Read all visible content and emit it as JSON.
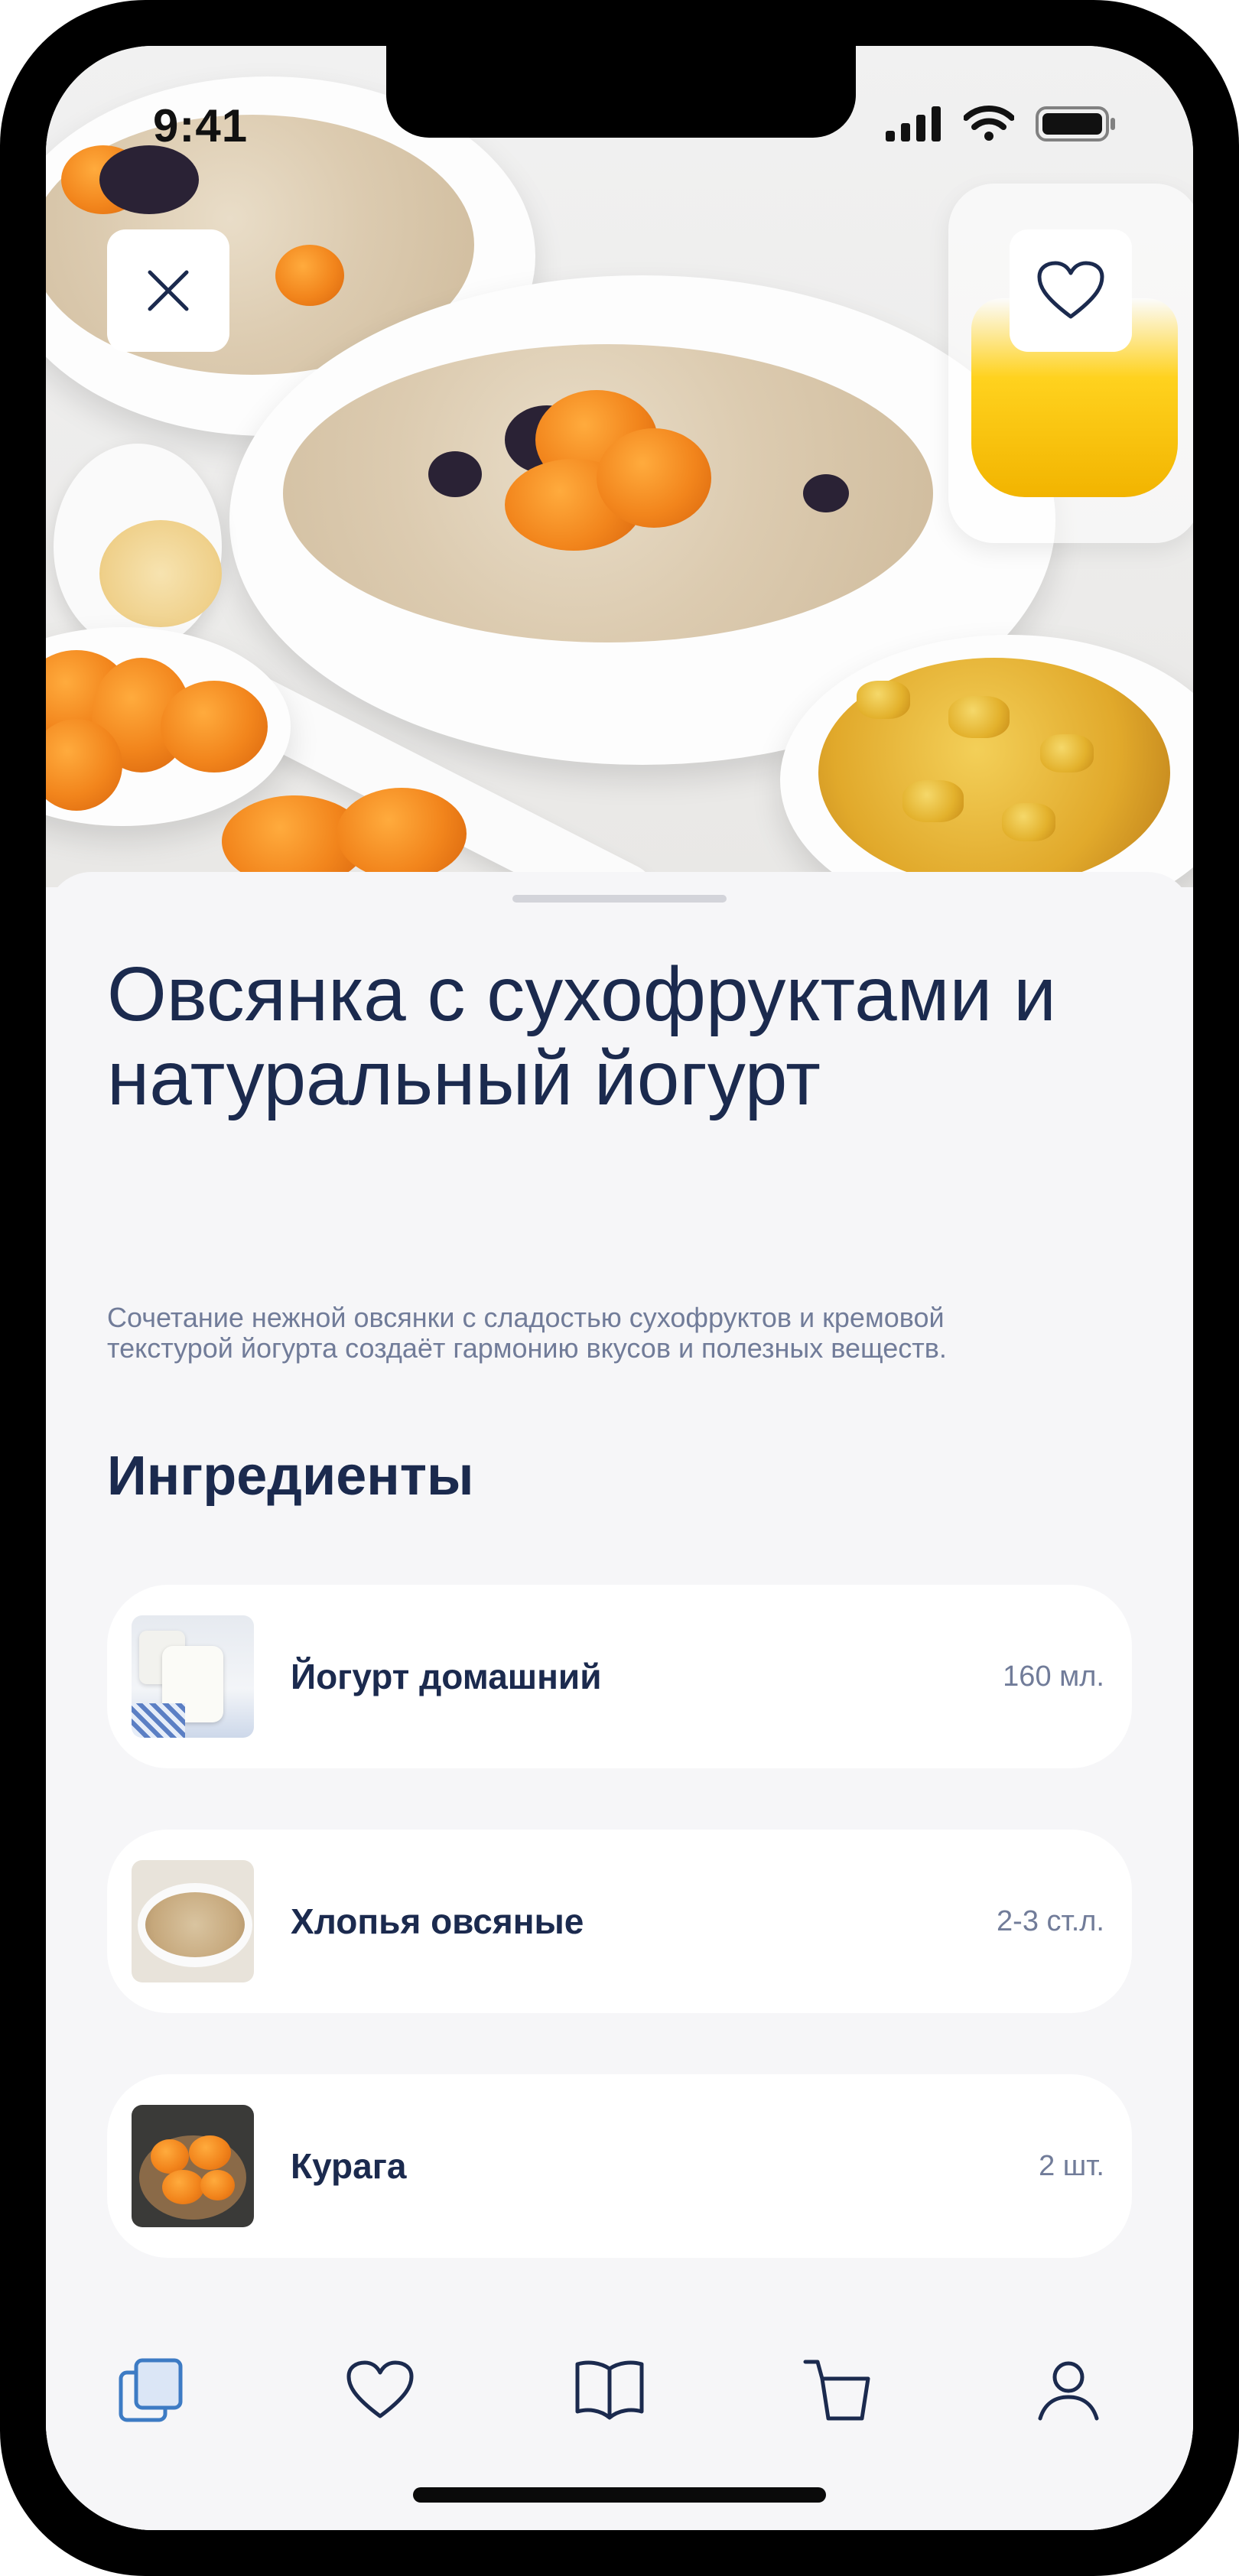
{
  "status_bar": {
    "time": "9:41"
  },
  "hero": {
    "image": "oatmeal-with-dried-fruits-photo",
    "close_icon": "close-icon",
    "favorite_icon": "heart-icon"
  },
  "recipe": {
    "title": "Овсянка с сухофруктами и натуральный йогурт",
    "description": "Сочетание нежной овсянки с сладостью сухофруктов и кремовой текстурой йогурта создаёт гармонию вкусов и полезных веществ."
  },
  "ingredients": {
    "heading": "Ингредиенты",
    "items": [
      {
        "name": "Йогурт домашний",
        "qty": "160 мл.",
        "image": "yogurt-jars"
      },
      {
        "name": "Хлопья овсяные",
        "qty": "2-3 ст.л.",
        "image": "oat-flakes-bowl"
      },
      {
        "name": "Курага",
        "qty": "2 шт.",
        "image": "dried-apricots"
      }
    ]
  },
  "tabbar": {
    "items": [
      {
        "icon": "recipes-stack-icon",
        "active": true
      },
      {
        "icon": "heart-icon",
        "active": false
      },
      {
        "icon": "book-icon",
        "active": false
      },
      {
        "icon": "cart-icon",
        "active": false
      },
      {
        "icon": "profile-icon",
        "active": false
      }
    ],
    "active_color": "#3d7bc4",
    "icon_color": "#1b2a4e"
  },
  "colors": {
    "title": "#1b2a4e",
    "secondary_text": "#717c99",
    "sheet_background": "#f6f6f8"
  }
}
